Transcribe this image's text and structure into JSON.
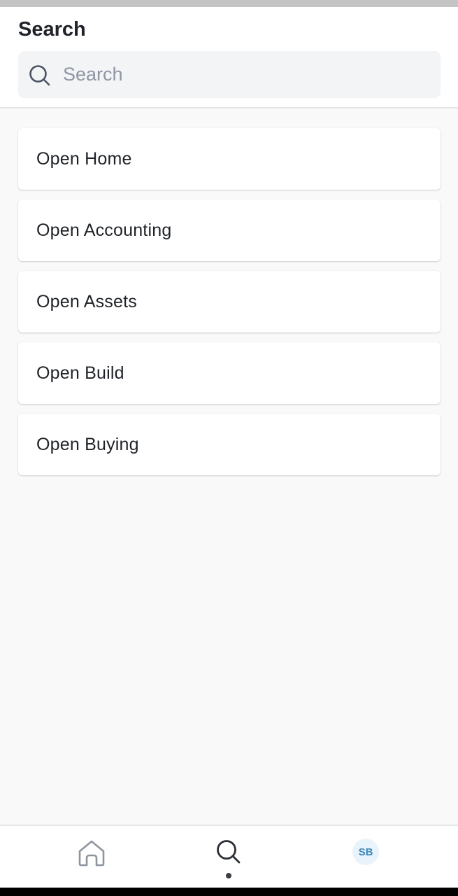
{
  "header": {
    "title": "Search"
  },
  "search": {
    "placeholder": "Search",
    "value": "",
    "icon": "search-icon"
  },
  "list": {
    "items": [
      {
        "label": "Open Home"
      },
      {
        "label": "Open Accounting"
      },
      {
        "label": "Open Assets"
      },
      {
        "label": "Open Build"
      },
      {
        "label": "Open Buying"
      }
    ]
  },
  "bottom_nav": {
    "items": [
      {
        "icon": "home-icon",
        "active": false
      },
      {
        "icon": "search-icon",
        "active": true
      },
      {
        "icon": "avatar",
        "initials": "SB",
        "active": false
      }
    ]
  },
  "colors": {
    "text": "#1f2328",
    "placeholder": "#8e96a3",
    "search_bg": "#f3f4f6",
    "page_bg": "#f9f9f9",
    "avatar_bg": "#e8f3fb",
    "avatar_text": "#3a86ba"
  }
}
